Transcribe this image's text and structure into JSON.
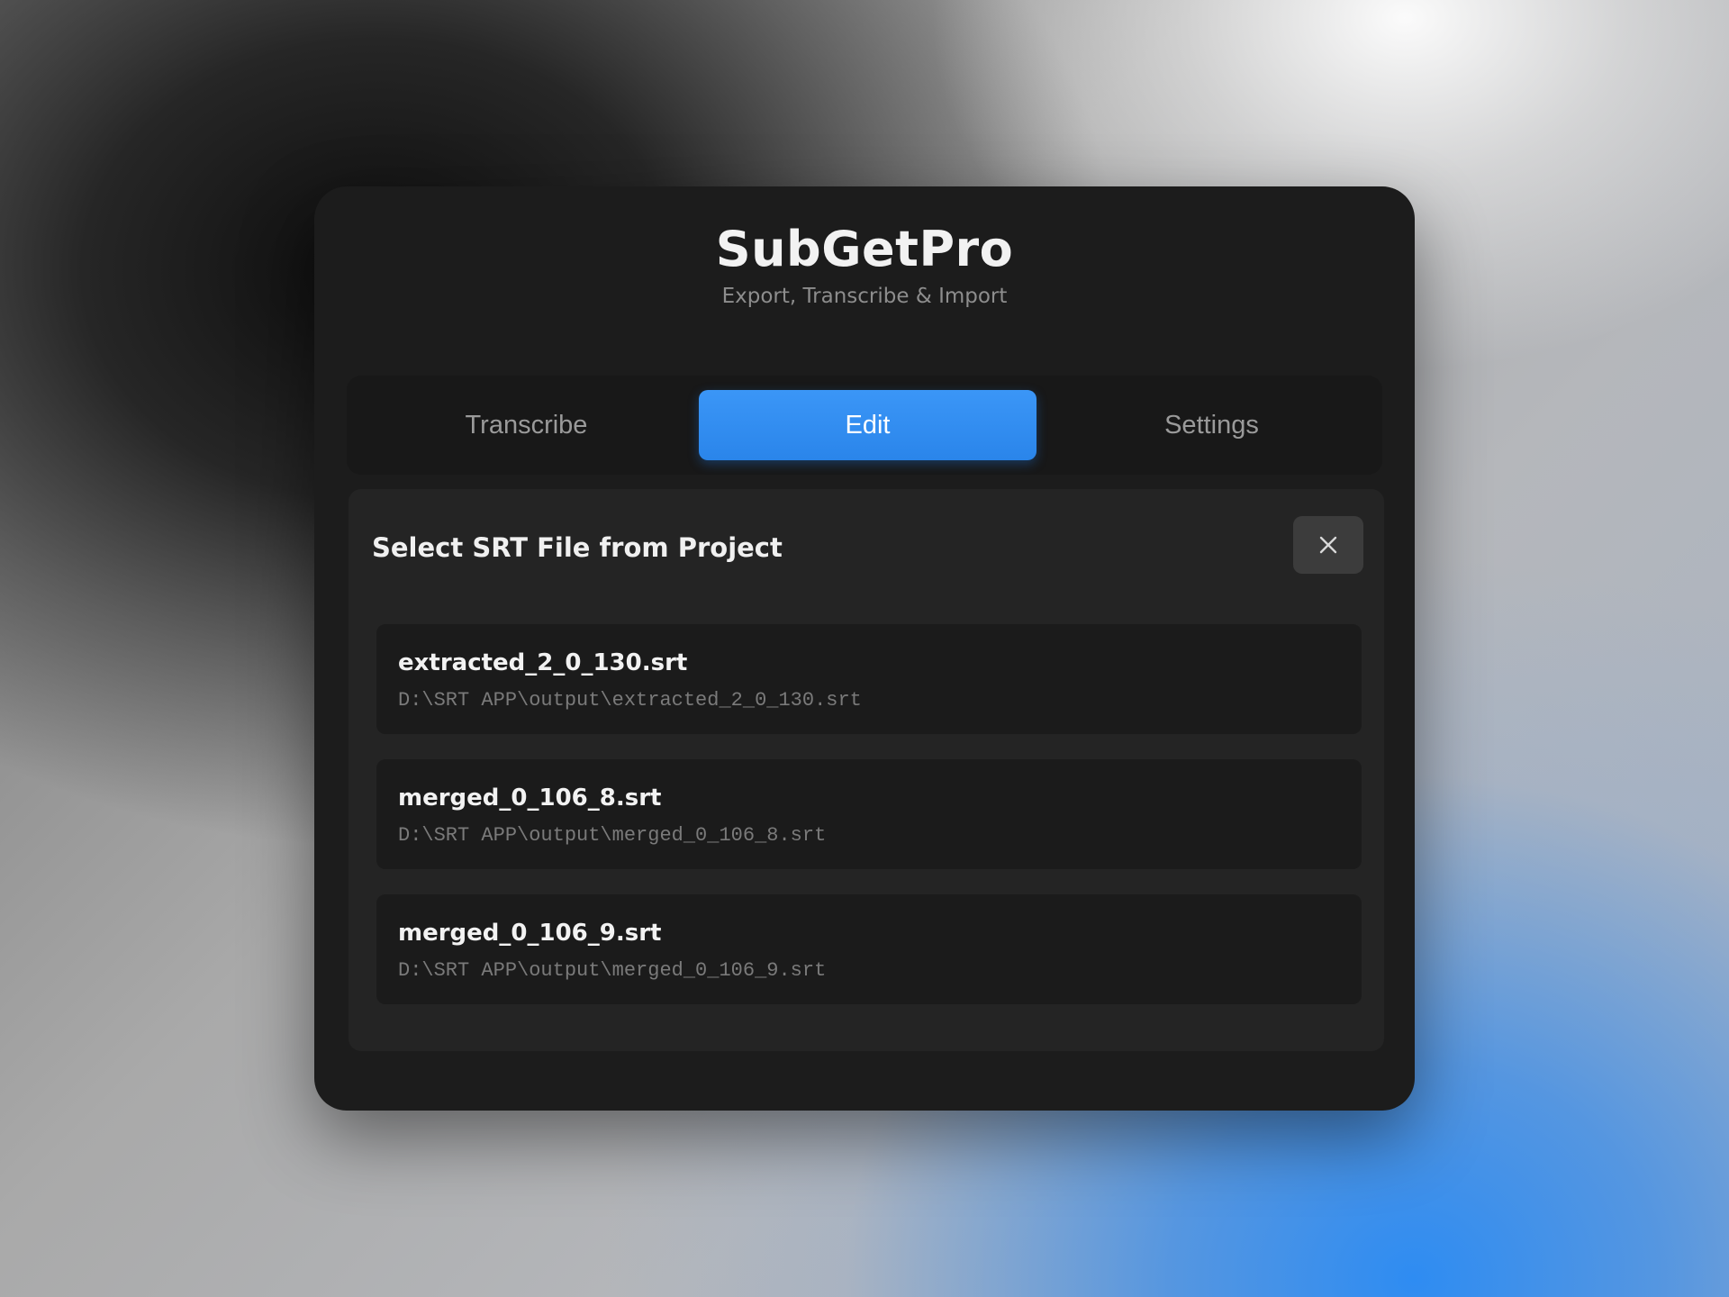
{
  "app": {
    "title": "SubGetPro",
    "subtitle": "Export, Transcribe & Import"
  },
  "tabs": [
    {
      "label": "Transcribe",
      "active": false
    },
    {
      "label": "Edit",
      "active": true
    },
    {
      "label": "Settings",
      "active": false
    }
  ],
  "dialog": {
    "title": "Select SRT File from Project",
    "close_icon": "close-icon",
    "files": [
      {
        "name": "extracted_2_0_130.srt",
        "path": "D:\\SRT APP\\output\\extracted_2_0_130.srt"
      },
      {
        "name": "merged_0_106_8.srt",
        "path": "D:\\SRT APP\\output\\merged_0_106_8.srt"
      },
      {
        "name": "merged_0_106_9.srt",
        "path": "D:\\SRT APP\\output\\merged_0_106_9.srt"
      }
    ]
  },
  "colors": {
    "accent": "#2a85ea",
    "window_bg": "#1c1c1c",
    "panel_bg": "#242424",
    "item_bg": "#1b1b1b"
  }
}
